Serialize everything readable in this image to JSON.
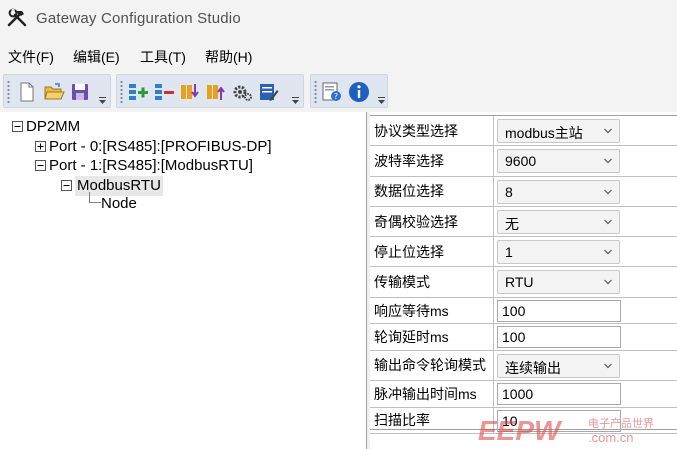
{
  "window": {
    "title": "Gateway Configuration Studio",
    "icon": "tools-hammer-wrench-icon"
  },
  "menu": [
    {
      "label": "文件(F)"
    },
    {
      "label": "编辑(E)"
    },
    {
      "label": "工具(T)"
    },
    {
      "label": "帮助(H)"
    }
  ],
  "toolbar": {
    "groups": [
      [
        "new-file-icon",
        "open-folder-icon",
        "save-icon"
      ],
      [
        "add-device-icon",
        "remove-device-icon",
        "download-icon",
        "upload-icon",
        "settings-gear-icon",
        "edit-config-icon"
      ],
      [
        "document-help-icon",
        "info-icon"
      ]
    ]
  },
  "tree": {
    "root": "DP2MM",
    "port0": "Port - 0:[RS485]:[PROFIBUS-DP]",
    "port1": "Port - 1:[RS485]:[ModbusRTU]",
    "modbus": "ModbusRTU",
    "node": "Node"
  },
  "properties": [
    {
      "label": "协议类型选择",
      "type": "select",
      "value": "modbus主站"
    },
    {
      "label": "波特率选择",
      "type": "select",
      "value": "9600"
    },
    {
      "label": "数据位选择",
      "type": "select",
      "value": "8"
    },
    {
      "label": "奇偶校验选择",
      "type": "select",
      "value": "无"
    },
    {
      "label": "停止位选择",
      "type": "select",
      "value": "1"
    },
    {
      "label": "传输模式",
      "type": "select",
      "value": "RTU"
    },
    {
      "label": "响应等待ms",
      "type": "input",
      "value": "100"
    },
    {
      "label": "轮询延时ms",
      "type": "input",
      "value": "100"
    },
    {
      "label": "输出命令轮询模式",
      "type": "select",
      "value": "连续输出"
    },
    {
      "label": "脉冲输出时间ms",
      "type": "input",
      "value": "1000"
    },
    {
      "label": "扫描比率",
      "type": "input",
      "value": "10"
    }
  ],
  "colors": {
    "chrome": "#f3f3f3",
    "toolbar_strip": "#dfe6f0",
    "watermark": "#e04040"
  },
  "watermark": {
    "logo": "EEPW",
    "domain": ".com.cn",
    "tagline": "电子产品世界"
  }
}
